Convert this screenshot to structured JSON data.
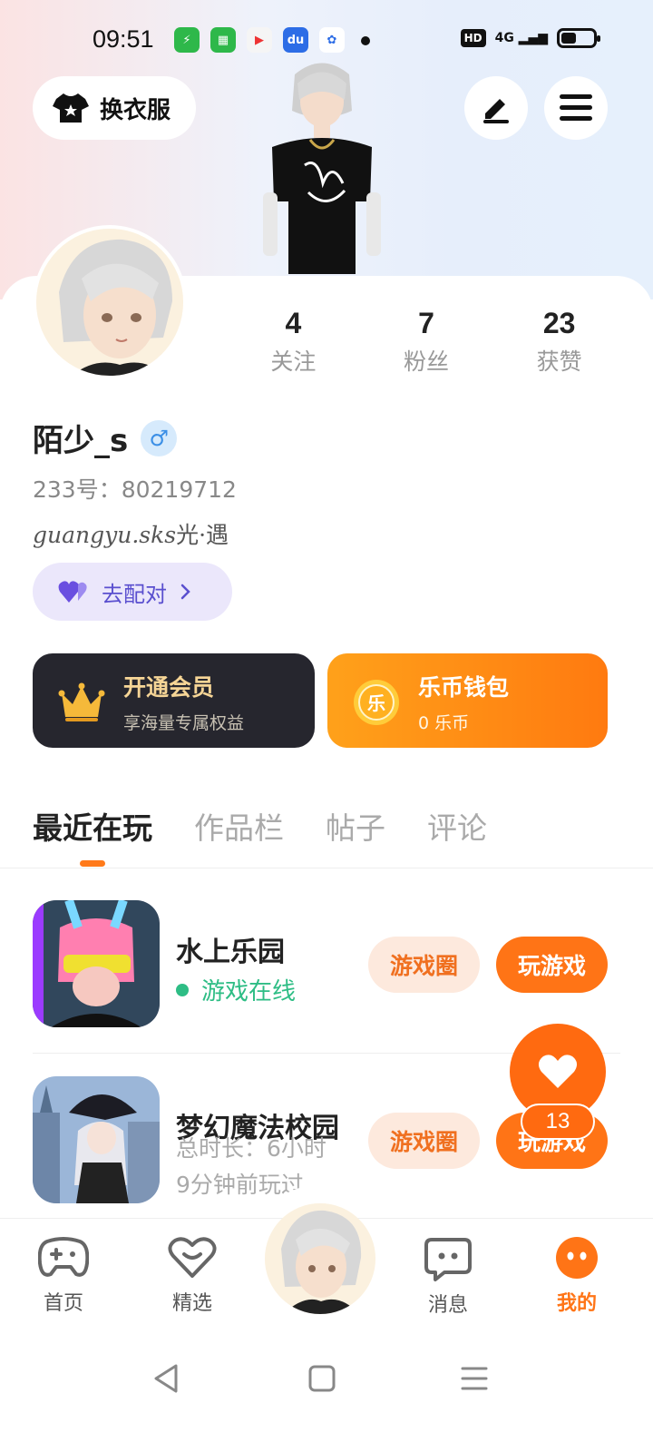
{
  "status_bar": {
    "time": "09:51",
    "hd": "HD",
    "network": "4G"
  },
  "header": {
    "outfit_label": "换衣服",
    "icons": [
      "tshirt-icon",
      "edit-icon",
      "menu-icon"
    ]
  },
  "profile": {
    "stats": [
      {
        "count": "4",
        "label": "关注"
      },
      {
        "count": "7",
        "label": "粉丝"
      },
      {
        "count": "23",
        "label": "获赞"
      }
    ],
    "username": "陌少_s",
    "gender_symbol": "♂",
    "uid_text": "233号：80219712",
    "bio_italic": "guangyu.sks",
    "bio_text": "光·遇",
    "match_label": "去配对"
  },
  "cards": {
    "vip_title": "开通会员",
    "vip_sub": "享海量专属权益",
    "wallet_title": "乐币钱包",
    "wallet_sub": "0 乐币",
    "coin_char": "乐"
  },
  "tabs": [
    "最近在玩",
    "作品栏",
    "帖子",
    "评论"
  ],
  "games": [
    {
      "name": "水上乐园",
      "status": "游戏在线",
      "circle_label": "游戏圈",
      "play_label": "玩游戏"
    },
    {
      "name": "梦幻魔法校园",
      "duration": "总时长：6小时",
      "last_played": "9分钟前玩过",
      "circle_label": "游戏圈",
      "play_label": "玩游戏"
    }
  ],
  "fab": {
    "count": "13"
  },
  "bottom_nav": [
    {
      "label": "首页"
    },
    {
      "label": "精选"
    },
    {
      "label": "消息"
    },
    {
      "label": "我的"
    }
  ],
  "colors": {
    "accent": "#ff7416",
    "online": "#2ebd85",
    "vip_gold": "#f6d596"
  }
}
